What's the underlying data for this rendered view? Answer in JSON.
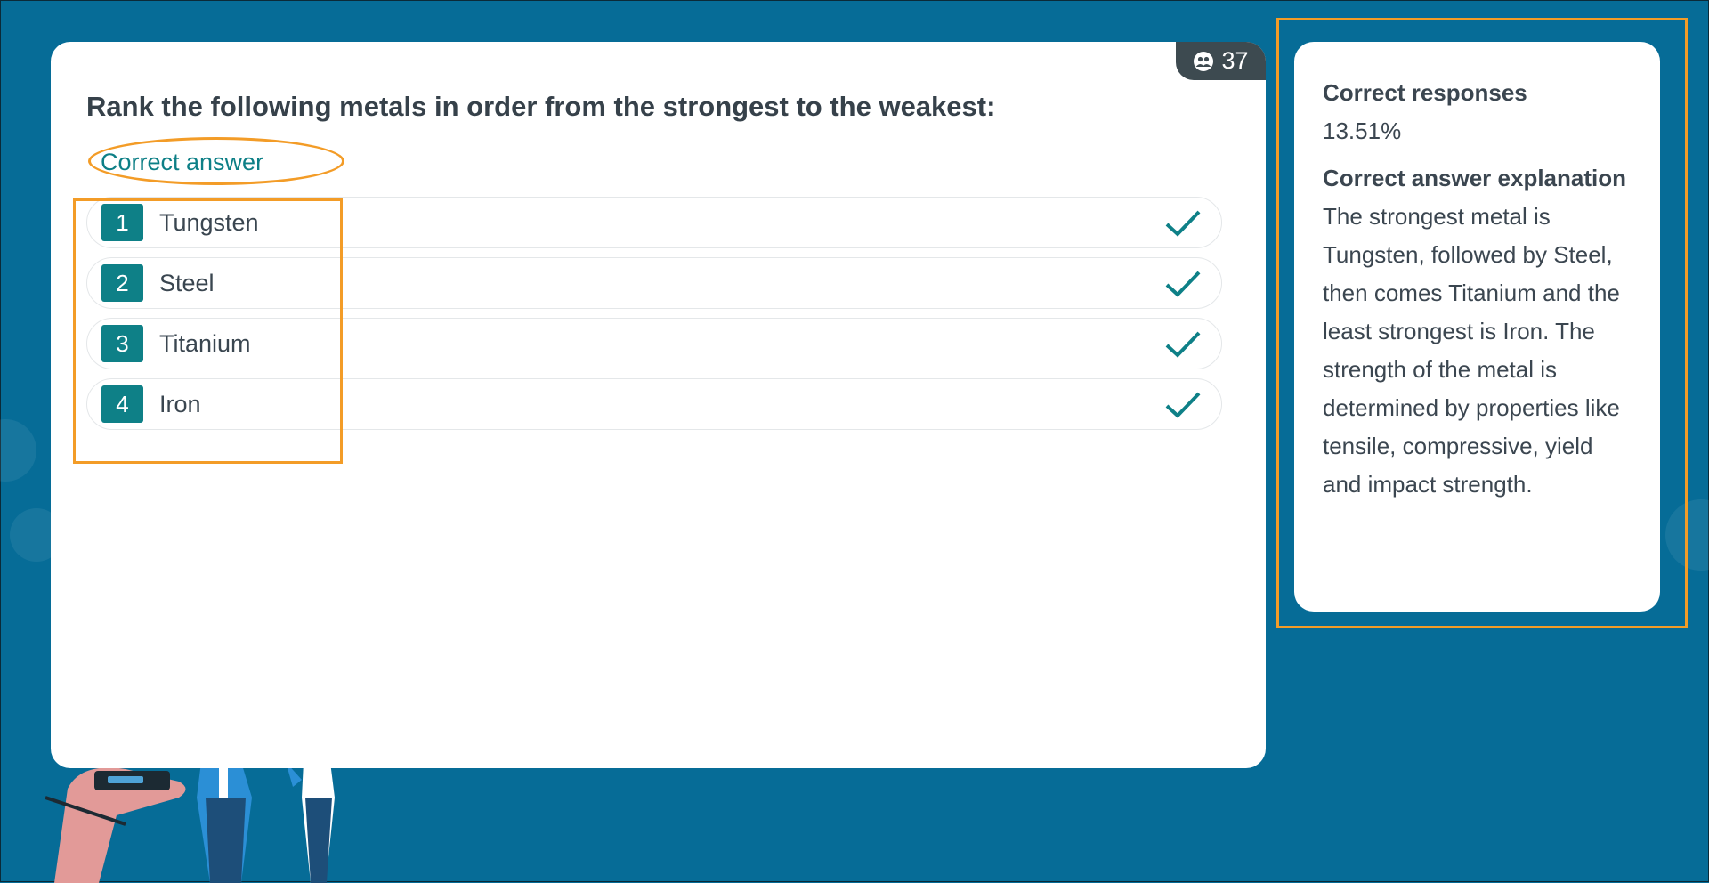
{
  "question": {
    "text": "Rank the following metals in order from the strongest to the weakest:",
    "participants_count": "37",
    "participant_icon": "participants-icon",
    "correct_answer_label": "Correct answer",
    "answers": [
      {
        "rank": "1",
        "label": "Tungsten",
        "correct": true
      },
      {
        "rank": "2",
        "label": "Steel",
        "correct": true
      },
      {
        "rank": "3",
        "label": "Titanium",
        "correct": true
      },
      {
        "rank": "4",
        "label": "Iron",
        "correct": true
      }
    ]
  },
  "stats": {
    "correct_responses_label": "Correct responses",
    "correct_responses_value": "13.51%",
    "explanation_label": "Correct answer explanation",
    "explanation_text": "The strongest metal is Tungsten, followed by Steel, then comes Titanium and the least strongest is Iron. The strength of the metal is determined by properties like tensile, compressive, yield and impact strength."
  },
  "colors": {
    "background": "#066c97",
    "accent": "#0e8087",
    "annotation": "#f39c27",
    "badge": "#3d4a50"
  }
}
